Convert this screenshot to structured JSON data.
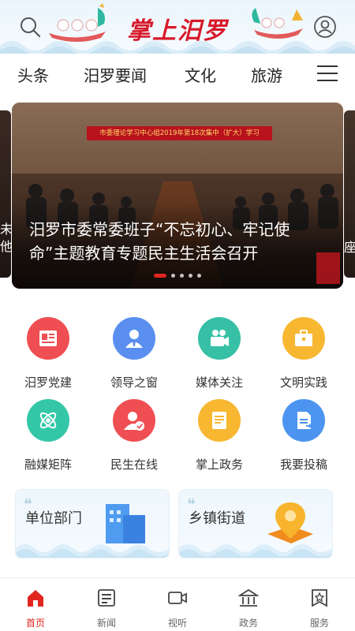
{
  "header": {
    "app_title": "掌上汨罗",
    "search_icon": "search-icon",
    "user_icon": "user-icon"
  },
  "nav": {
    "tabs": [
      {
        "label": "头条"
      },
      {
        "label": "汨罗要闻"
      },
      {
        "label": "文化"
      },
      {
        "label": "旅游"
      }
    ],
    "menu_icon": "menu-icon"
  },
  "carousel": {
    "banner_text": "市委理论学习中心组2019年第18次集中（扩大）学习",
    "caption": "汨罗市委常委班子“不忘初心、牢记使命”主题教育专题民主生活会召开",
    "peek_left_text": "未\n他",
    "peek_right_text": "座",
    "slide_count": 5,
    "active_index": 0
  },
  "grid": {
    "items": [
      {
        "label": "汨罗党建",
        "icon": "party-book-icon",
        "color": "#ef4f52"
      },
      {
        "label": "领导之窗",
        "icon": "leader-icon",
        "color": "#5a8ff0"
      },
      {
        "label": "媒体关注",
        "icon": "camera-icon",
        "color": "#37c0a6"
      },
      {
        "label": "文明实践",
        "icon": "briefcase-icon",
        "color": "#f7b731"
      },
      {
        "label": "融媒矩阵",
        "icon": "atom-icon",
        "color": "#33c7a8"
      },
      {
        "label": "民生在线",
        "icon": "user-check-icon",
        "color": "#ef4f52"
      },
      {
        "label": "掌上政务",
        "icon": "document-icon",
        "color": "#f7b731"
      },
      {
        "label": "我要投稿",
        "icon": "submit-icon",
        "color": "#4c94f0"
      }
    ]
  },
  "cards": [
    {
      "title": "单位部门",
      "icon": "building-icon"
    },
    {
      "title": "乡镇街道",
      "icon": "location-pin-icon"
    }
  ],
  "bottom_bar": {
    "items": [
      {
        "label": "首页",
        "icon": "home-icon",
        "active": true
      },
      {
        "label": "新闻",
        "icon": "news-icon",
        "active": false
      },
      {
        "label": "视听",
        "icon": "video-icon",
        "active": false
      },
      {
        "label": "政务",
        "icon": "government-icon",
        "active": false
      },
      {
        "label": "服务",
        "icon": "service-icon",
        "active": false
      }
    ]
  },
  "colors": {
    "brand_red": "#e0261f",
    "logo_red": "#d8192a"
  }
}
